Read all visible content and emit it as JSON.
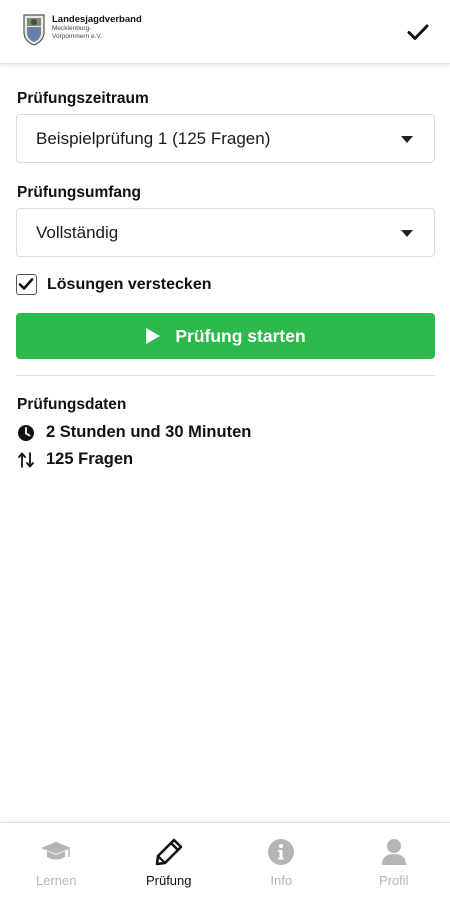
{
  "header": {
    "logo_title": "Landesjagdverband",
    "logo_subtitle_line1": "Mecklenburg-",
    "logo_subtitle_line2": "Vorpommern e.V.",
    "confirm_icon": "checkmark-icon"
  },
  "form": {
    "period_label": "Prüfungszeitraum",
    "period_value": "Beispielprüfung 1 (125 Fragen)",
    "scope_label": "Prüfungsumfang",
    "scope_value": "Vollständig",
    "hide_solutions_label": "Lösungen verstecken",
    "hide_solutions_checked": true,
    "start_button_label": "Prüfung starten"
  },
  "exam_data": {
    "title": "Prüfungsdaten",
    "duration": "2 Stunden und 30 Minuten",
    "duration_icon": "clock-icon",
    "questions": "125 Fragen",
    "questions_icon": "sort-icon"
  },
  "colors": {
    "accent_green": "#2cb84a",
    "nav_inactive": "#b5b5b5",
    "nav_active": "#111111"
  },
  "nav": {
    "items": [
      {
        "label": "Lernen",
        "icon": "graduation-cap-icon",
        "active": false
      },
      {
        "label": "Prüfung",
        "icon": "pencil-icon",
        "active": true
      },
      {
        "label": "Info",
        "icon": "info-icon",
        "active": false
      },
      {
        "label": "Profil",
        "icon": "user-icon",
        "active": false
      }
    ]
  }
}
